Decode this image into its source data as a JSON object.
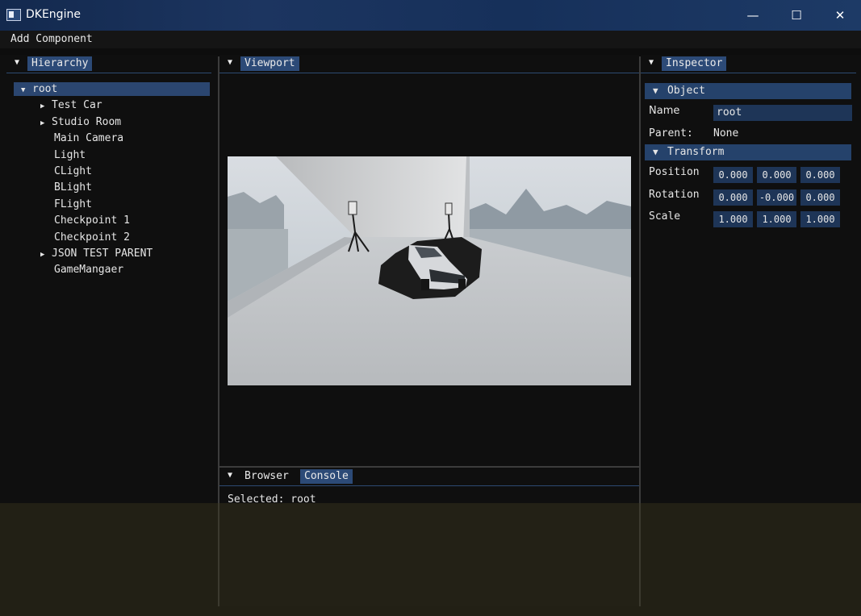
{
  "window": {
    "title": "DKEngine",
    "minimize": "—",
    "maximize": "☐",
    "close": "✕"
  },
  "menu": {
    "add_component": "Add Component"
  },
  "hierarchy": {
    "tab": "Hierarchy",
    "items": [
      {
        "label": "root",
        "expander": "▼"
      },
      {
        "label": "Test Car",
        "expander": "▶"
      },
      {
        "label": "Studio Room",
        "expander": "▶"
      },
      {
        "label": "Main Camera",
        "expander": ""
      },
      {
        "label": "Light",
        "expander": ""
      },
      {
        "label": "CLight",
        "expander": ""
      },
      {
        "label": "BLight",
        "expander": ""
      },
      {
        "label": "FLight",
        "expander": ""
      },
      {
        "label": "Checkpoint 1",
        "expander": ""
      },
      {
        "label": "Checkpoint 2",
        "expander": ""
      },
      {
        "label": "JSON TEST PARENT",
        "expander": "▶"
      },
      {
        "label": "GameMangaer",
        "expander": ""
      }
    ]
  },
  "viewport": {
    "tab": "Viewport"
  },
  "bottom": {
    "tabs": [
      {
        "label": "Browser"
      },
      {
        "label": "Console"
      }
    ],
    "console_line": "Selected: root"
  },
  "inspector": {
    "tab": "Inspector",
    "object_section": "Object",
    "section_arrow": "▼",
    "name_label": "Name",
    "name_value": "root",
    "parent_label": "Parent:",
    "parent_value": "None",
    "transform_section": "Transform",
    "position_label": "Position",
    "rotation_label": "Rotation",
    "scale_label": "Scale",
    "position": [
      "0.000",
      "0.000",
      "0.000"
    ],
    "rotation": [
      "0.000",
      "-0.000",
      "0.000"
    ],
    "scale": [
      "1.000",
      "1.000",
      "1.000"
    ]
  },
  "icons": {
    "collapse": "▼"
  },
  "colors": {
    "accent": "#2c4a77",
    "field": "#1e3557",
    "titlebar": "#1c3560"
  }
}
